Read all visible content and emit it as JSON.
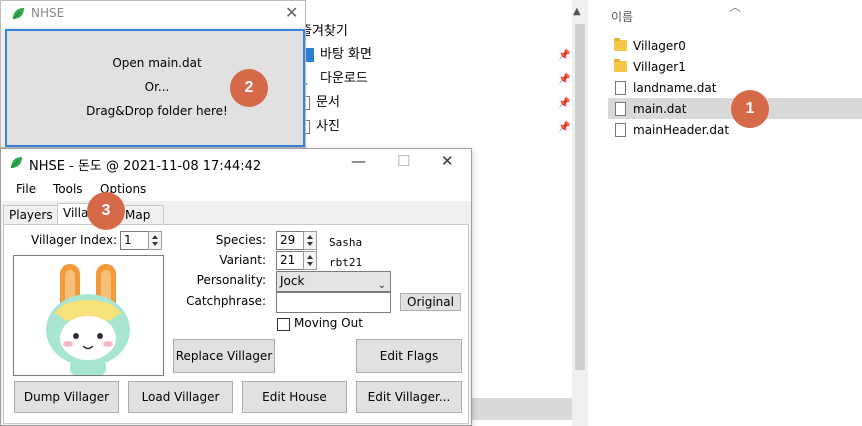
{
  "explorer": {
    "nav_items": [
      {
        "label": "즐겨찾기"
      },
      {
        "label": "바탕 화면"
      },
      {
        "label": "다운로드"
      },
      {
        "label": "문서"
      },
      {
        "label": "사진"
      }
    ],
    "column_name": "이름",
    "files": [
      {
        "name": "Villager0",
        "kind": "folder"
      },
      {
        "name": "Villager1",
        "kind": "folder"
      },
      {
        "name": "landname.dat",
        "kind": "file"
      },
      {
        "name": "main.dat",
        "kind": "file",
        "selected": true
      },
      {
        "name": "mainHeader.dat",
        "kind": "file"
      }
    ]
  },
  "badges": {
    "one": "1",
    "two": "2",
    "three": "3"
  },
  "startup_window": {
    "title": "NHSE",
    "line1": "Open main.dat",
    "line2": "Or...",
    "line3": "Drag&Drop folder here!"
  },
  "main_window": {
    "title": "NHSE - 돈도 @ 2021-11-08 17:44:42",
    "menu": [
      "File",
      "Tools",
      "Options"
    ],
    "tabs": [
      "Players",
      "Villagers",
      "Map"
    ],
    "villager_index_label": "Villager Index:",
    "villager_index_value": "1",
    "species_label": "Species:",
    "species_value": "29",
    "species_name": "Sasha",
    "variant_label": "Variant:",
    "variant_value": "21",
    "variant_code": "rbt21",
    "personality_label": "Personality:",
    "personality_value": "Jock",
    "catchphrase_label": "Catchphrase:",
    "catchphrase_value": "",
    "original_button": "Original",
    "moving_out_label": "Moving Out",
    "replace_button": "Replace Villager",
    "edit_flags_button": "Edit Flags",
    "dump_button": "Dump Villager",
    "load_button": "Load Villager",
    "edit_house_button": "Edit House",
    "edit_villager_button": "Edit Villager..."
  },
  "colors": {
    "accent": "#3a84d8",
    "badge": "#d66a48",
    "leaf": "#2fa84f"
  }
}
